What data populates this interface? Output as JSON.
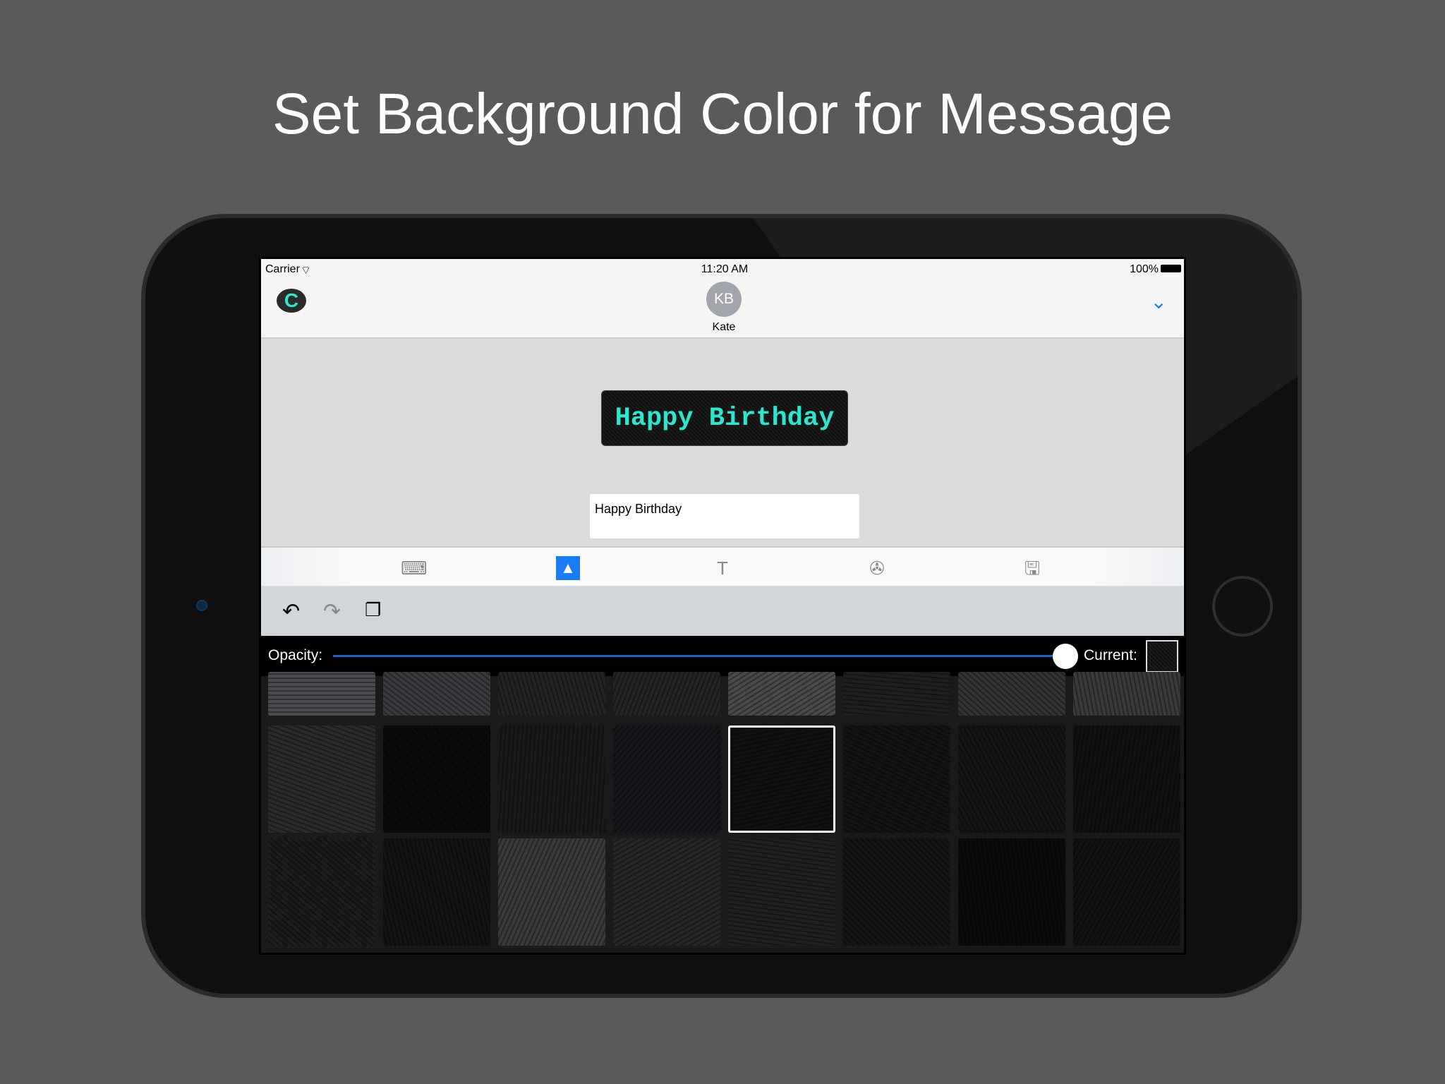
{
  "headline": "Set Background Color for Message",
  "status": {
    "carrier": "Carrier",
    "time": "11:20 AM",
    "battery": "100%"
  },
  "nav": {
    "app_icon": "C",
    "avatar_initials": "KB",
    "contact": "Kate",
    "collapse_icon": "chevron-down-icon"
  },
  "message": {
    "bubble_text": "Happy Birthday",
    "text_color": "#2ee6d0",
    "input_value": "Happy Birthday"
  },
  "toolbar": {
    "items": [
      {
        "icon": "keyboard-icon"
      },
      {
        "icon": "image-icon",
        "active": true
      },
      {
        "icon": "text-icon"
      },
      {
        "icon": "film-reel-icon"
      },
      {
        "icon": "save-icon"
      }
    ]
  },
  "edit": {
    "items": [
      {
        "icon": "undo-icon"
      },
      {
        "icon": "redo-icon"
      },
      {
        "icon": "copy-icon"
      }
    ]
  },
  "opacity": {
    "label": "Opacity:",
    "value": 1.0,
    "current_label": "Current:"
  },
  "backgrounds": {
    "rows": 3,
    "columns": 8,
    "selected_row": 1,
    "selected_col": 4
  },
  "colors": {
    "accent": "#1a7cf5",
    "background": "#5a5a5a"
  }
}
